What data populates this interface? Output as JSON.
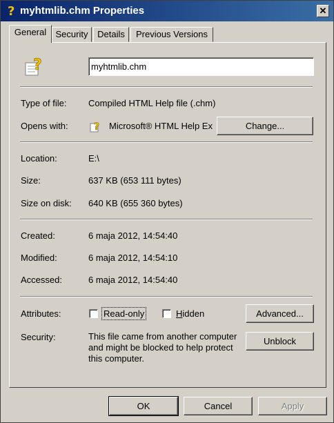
{
  "window": {
    "title": "myhtmlib.chm Properties",
    "close_label": "✕"
  },
  "tabs": [
    {
      "label": "General",
      "active": true
    },
    {
      "label": "Security",
      "active": false
    },
    {
      "label": "Details",
      "active": false
    },
    {
      "label": "Previous Versions",
      "active": false
    }
  ],
  "general": {
    "file_name": "myhtmlib.chm",
    "type_of_file_label": "Type of file:",
    "type_of_file_value": "Compiled HTML Help file (.chm)",
    "opens_with_label": "Opens with:",
    "opens_with_value": "Microsoft® HTML Help Ex",
    "change_button": "Change...",
    "location_label": "Location:",
    "location_value": "E:\\",
    "size_label": "Size:",
    "size_value": "637 KB (653 111 bytes)",
    "size_on_disk_label": "Size on disk:",
    "size_on_disk_value": "640 KB (655 360 bytes)",
    "created_label": "Created:",
    "created_value": "6 maja 2012, 14:54:40",
    "modified_label": "Modified:",
    "modified_value": "6 maja 2012, 14:54:10",
    "accessed_label": "Accessed:",
    "accessed_value": "6 maja 2012, 14:54:40",
    "attributes_label": "Attributes:",
    "readonly_label": "Read-only",
    "readonly_checked": false,
    "hidden_label": "Hidden",
    "hidden_checked": false,
    "advanced_button": "Advanced...",
    "security_label": "Security:",
    "security_text": "This file came from another computer and might be blocked to help protect this computer.",
    "unblock_button": "Unblock"
  },
  "footer": {
    "ok_button": "OK",
    "cancel_button": "Cancel",
    "apply_button": "Apply"
  },
  "icons": {
    "title": "help-file-icon",
    "file": "help-file-icon",
    "opens_with": "html-help-icon"
  },
  "colors": {
    "face": "#d4d0c8",
    "title_start": "#0a246a",
    "title_end": "#3a6ea5"
  }
}
